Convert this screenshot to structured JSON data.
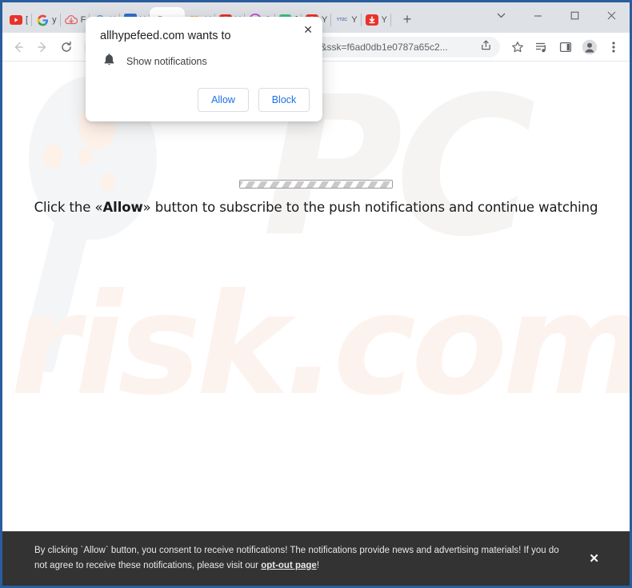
{
  "window": {
    "controls": {
      "tab_search": "tab-search-chevron",
      "minimize": "—",
      "maximize": "☐",
      "close": "✕"
    }
  },
  "tabstrip": {
    "new_tab_label": "+",
    "active_tab_close": "✕",
    "tabs": [
      {
        "favicon": "youtube",
        "title": "[",
        "active": false
      },
      {
        "favicon": "google",
        "title": "y",
        "active": false
      },
      {
        "favicon": "cloud-arrow-red",
        "title": "F",
        "active": false
      },
      {
        "favicon": "cloud-arrow-blue",
        "title": "Y",
        "active": false
      },
      {
        "favicon": "blue-square-swoosh",
        "title": "Y",
        "active": false
      },
      {
        "favicon": "none",
        "title": "P",
        "active": true
      },
      {
        "favicon": "movie-camera",
        "title": "Y",
        "active": false
      },
      {
        "favicon": "youtube-download",
        "title": "Y",
        "active": false
      },
      {
        "favicon": "play-gradient",
        "title": "C",
        "active": false
      },
      {
        "favicon": "green-download",
        "title": "[",
        "active": false
      },
      {
        "favicon": "youtube-download",
        "title": "Y",
        "active": false
      },
      {
        "favicon": "yt2c-text",
        "title": "Y",
        "active": false
      },
      {
        "favicon": "youtube-download",
        "title": "Y",
        "active": false
      }
    ]
  },
  "toolbar": {
    "back_label": "back-arrow",
    "forward_label": "forward-arrow",
    "reload_label": "reload-arrow",
    "url": "https://allhypefeed.com/?s=682648877937205318&ssk=f6ad0db1e0787a65c2...",
    "lock_icon": "padlock",
    "share_icon": "share",
    "bookmark_icon": "star",
    "reading_list_icon": "reading-list",
    "side_panel_icon": "side-panel",
    "profile_icon": "profile-avatar",
    "menu_icon": "three-dot-menu"
  },
  "page": {
    "watermark_pc": "PC",
    "watermark_risk": "risk.com",
    "hero_prefix": "Click the «Allow»",
    "hero_bold": "Allow",
    "hero_text_before": "Click the «",
    "hero_text_after": "» button to subscribe to the push notifications and continue watching",
    "progress_label": "loading-progress"
  },
  "banner": {
    "text_part1": "By clicking `Allow` button, you consent to receive notifications! The notifications provide news and advertising materials! If you do not agree to receive these notifications, please visit our ",
    "link_text": "opt-out page",
    "text_part2": "!",
    "close_label": "✕"
  },
  "permission_dialog": {
    "title": "allhypefeed.com wants to",
    "permission_label": "Show notifications",
    "permission_icon": "bell-icon",
    "allow_label": "Allow",
    "block_label": "Block",
    "close_label": "✕",
    "accent_color": "#1a73e8"
  }
}
